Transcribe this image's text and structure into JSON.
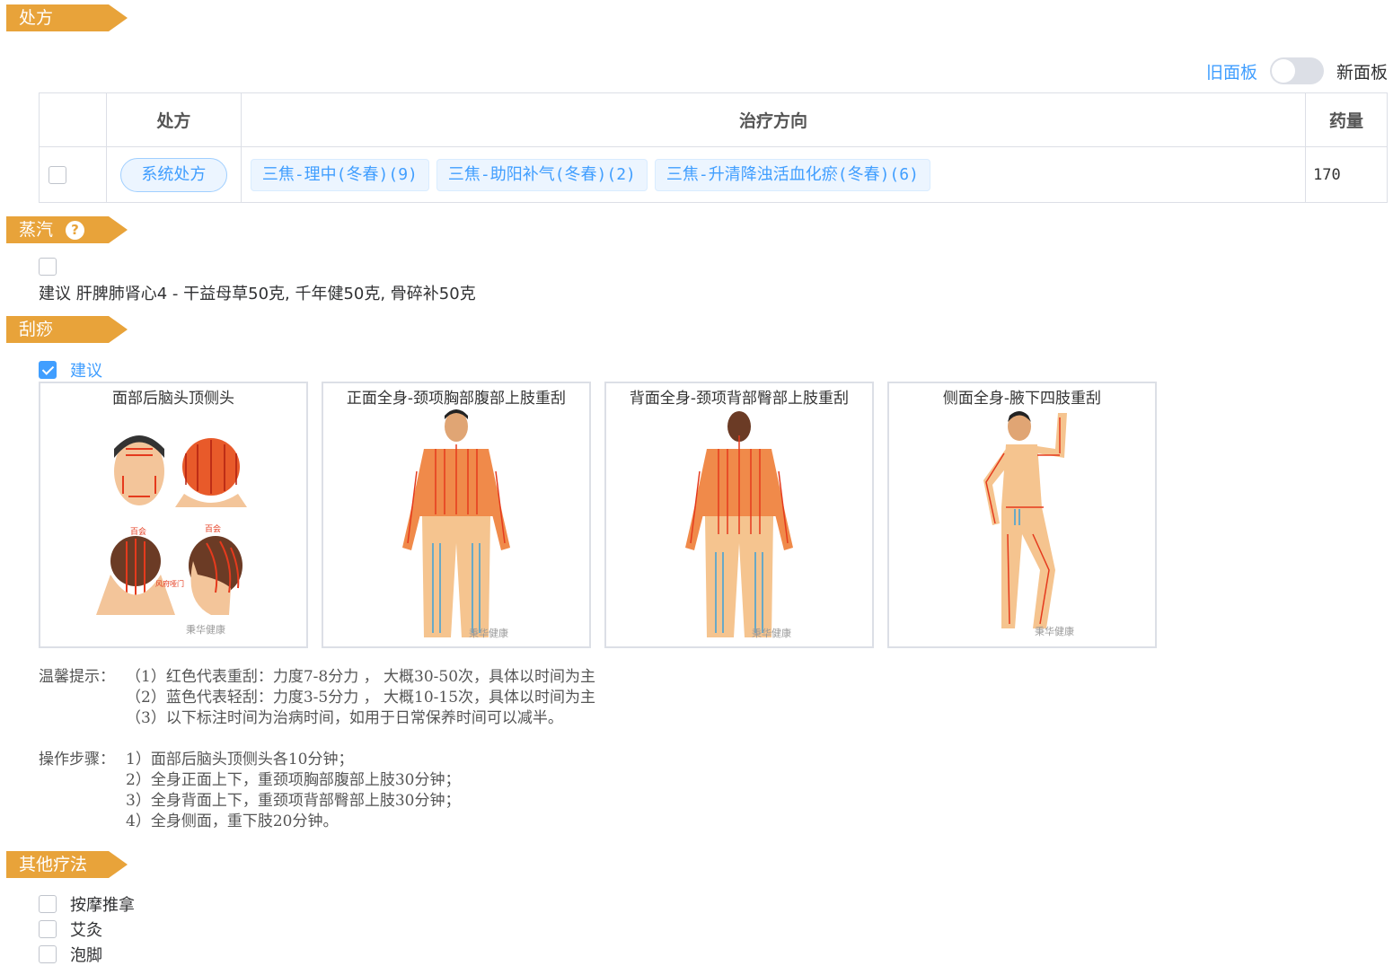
{
  "sections": {
    "prescription": "处方",
    "steam": "蒸汽",
    "guasha": "刮痧",
    "other": "其他疗法"
  },
  "panel_toggle": {
    "old_label": "旧面板",
    "new_label": "新面板",
    "state": "off"
  },
  "table": {
    "headers": [
      "处方",
      "治疗方向",
      "药量"
    ],
    "rows": [
      {
        "checked": false,
        "button": "系统处方",
        "tags": [
          "三焦-理中(冬春)(9)",
          "三焦-助阳补气(冬春)(2)",
          "三焦-升清降浊活血化瘀(冬春)(6)"
        ],
        "dose": "170"
      }
    ]
  },
  "steam": {
    "checked": false,
    "suggestion": "建议 肝脾肺肾心4 - 干益母草50克, 千年健50克, 骨碎补50克"
  },
  "guasha": {
    "checked": true,
    "checkbox_label": "建议",
    "cards": [
      {
        "title": "面部后脑头顶侧头",
        "labels": [
          "百会",
          "百会",
          "风府哑门"
        ],
        "watermark": "秉华健康"
      },
      {
        "title": "正面全身-颈项胸部腹部上肢重刮",
        "watermark": "秉华健康"
      },
      {
        "title": "背面全身-颈项背部臀部上肢重刮",
        "watermark": "秉华健康"
      },
      {
        "title": "侧面全身-腋下四肢重刮",
        "watermark": "秉华健康"
      }
    ],
    "tips_label": "温馨提示：",
    "tips": [
      "（1）红色代表重刮：力度7-8分力 ， 大概30-50次，具体以时间为主",
      "（2）蓝色代表轻刮：力度3-5分力 ， 大概10-15次，具体以时间为主",
      "（3）以下标注时间为治病时间，如用于日常保养时间可以减半。"
    ],
    "steps_label": "操作步骤：",
    "steps": [
      "1）面部后脑头顶侧头各10分钟；",
      "2）全身正面上下，重颈项胸部腹部上肢30分钟；",
      "3）全身背面上下，重颈项背部臀部上肢30分钟；",
      "4）全身侧面，重下肢20分钟。"
    ]
  },
  "other": {
    "items": [
      {
        "label": "按摩推拿",
        "checked": false
      },
      {
        "label": "艾灸",
        "checked": false
      },
      {
        "label": "泡脚",
        "checked": false
      }
    ]
  },
  "colors": {
    "accent": "#e8a33a",
    "primary": "#409eff",
    "heavy": "#e53a1d",
    "light": "#3aa0d8",
    "skin": "#f5b97a"
  }
}
